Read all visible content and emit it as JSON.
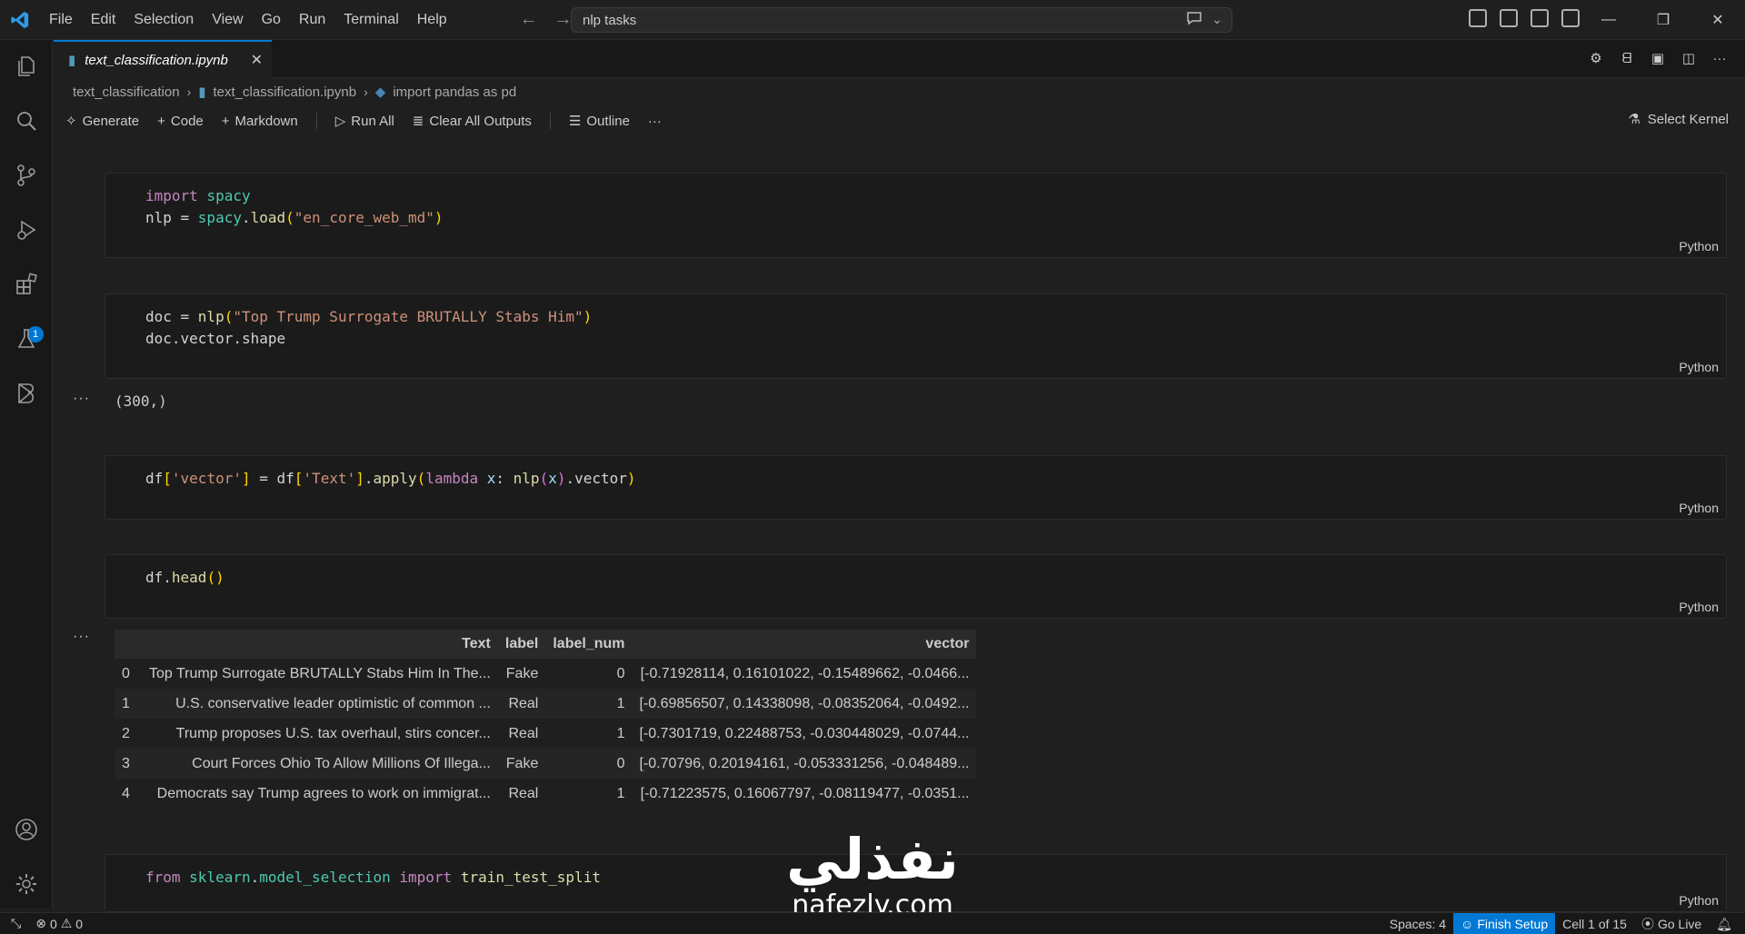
{
  "menu": [
    "File",
    "Edit",
    "Selection",
    "View",
    "Go",
    "Run",
    "Terminal",
    "Help"
  ],
  "search": {
    "value": "nlp tasks"
  },
  "tab": {
    "title": "text_classification.ipynb",
    "close": "✕"
  },
  "breadcrumb": {
    "folder": "text_classification",
    "file": "text_classification.ipynb",
    "symbol": "import pandas as pd"
  },
  "toolbar": {
    "generate": "Generate",
    "code": "Code",
    "markdown": "Markdown",
    "run_all": "Run All",
    "clear_outputs": "Clear All Outputs",
    "outline": "Outline",
    "more": "···",
    "select_kernel": "Select Kernel"
  },
  "activity_badge": "1",
  "cells": {
    "c1": {
      "lang": "Python"
    },
    "c2": {
      "lang": "Python",
      "output": "(300,)"
    },
    "c3": {
      "lang": "Python"
    },
    "c4": {
      "lang": "Python"
    },
    "c5": {
      "lang": "Python"
    },
    "output_dots": "···"
  },
  "table": {
    "headers": [
      "",
      "Text",
      "label",
      "label_num",
      "vector"
    ],
    "rows": [
      [
        "0",
        "Top Trump Surrogate BRUTALLY Stabs Him In The...",
        "Fake",
        "0",
        "[-0.71928114, 0.16101022, -0.15489662, -0.0466..."
      ],
      [
        "1",
        "U.S. conservative leader optimistic of common ...",
        "Real",
        "1",
        "[-0.69856507, 0.14338098, -0.08352064, -0.0492..."
      ],
      [
        "2",
        "Trump proposes U.S. tax overhaul, stirs concer...",
        "Real",
        "1",
        "[-0.7301719, 0.22488753, -0.030448029, -0.0744..."
      ],
      [
        "3",
        "Court Forces Ohio To Allow Millions Of Illega...",
        "Fake",
        "0",
        "[-0.70796, 0.20194161, -0.053331256, -0.048489..."
      ],
      [
        "4",
        "Democrats say Trump agrees to work on immigrat...",
        "Real",
        "1",
        "[-0.71223575, 0.16067797, -0.08119477, -0.0351..."
      ]
    ]
  },
  "watermark": {
    "arabic": "نفذلي",
    "latin": "nafezly.com"
  },
  "status": {
    "errors": "0",
    "warnings": "0",
    "spaces": "Spaces: 4",
    "finish_setup": "Finish Setup",
    "cell": "Cell 1 of 15",
    "go_live": "Go Live"
  },
  "colors": {
    "accent": "#0078d4",
    "background": "#1f1f1f",
    "keyword": "#c586c0",
    "function": "#dcdcaa",
    "module": "#4ec9b0",
    "string": "#ce9178"
  }
}
